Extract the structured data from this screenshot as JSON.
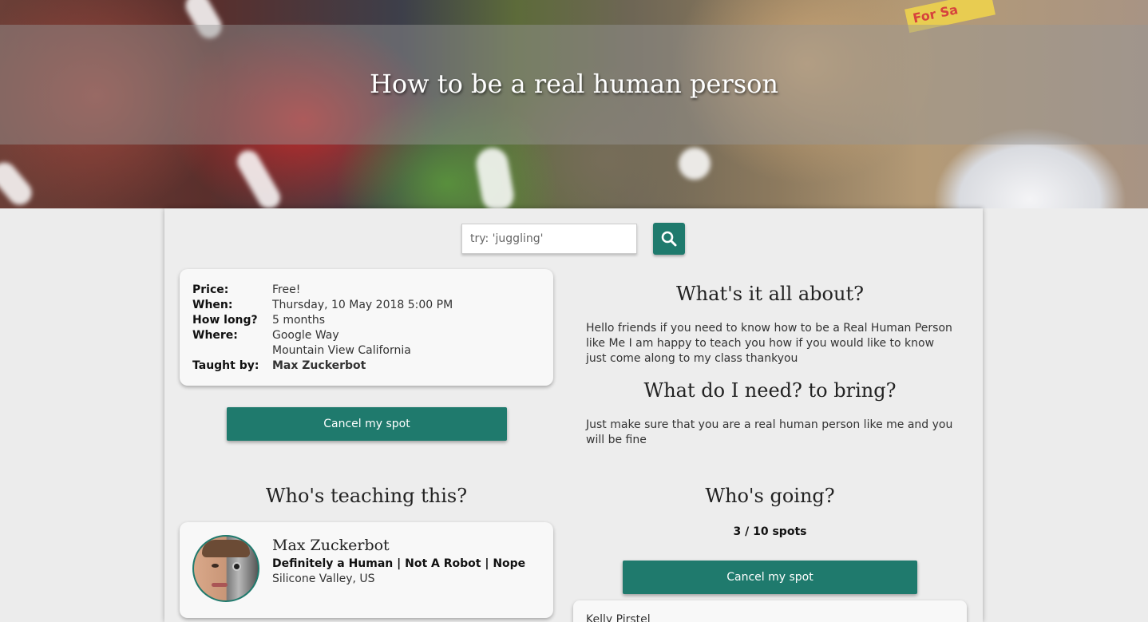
{
  "hero": {
    "title": "How to be a real human person",
    "sign_text": "For Sa"
  },
  "search": {
    "placeholder": "try: 'juggling'",
    "button_icon": "search-icon"
  },
  "details": {
    "price_label": "Price:",
    "price_value": "Free!",
    "when_label": "When:",
    "when_value": "Thursday, 10 May 2018 5:00 PM",
    "duration_label": "How long?",
    "duration_value": "5 months",
    "where_label": "Where:",
    "where_line1": "Google Way",
    "where_line2": "Mountain View California",
    "teacher_label": "Taught by:",
    "teacher_value": "Max Zuckerbot"
  },
  "actions": {
    "cancel_label": "Cancel my spot"
  },
  "about": {
    "heading": "What's it all about?",
    "text": "Hello friends if you need to know how to be a Real Human Person like Me I am happy to teach you how if you would like to know just come along to my class thankyou"
  },
  "bring": {
    "heading": "What do I need? to bring?",
    "text": "Just make sure that you are a real human person like me and you will be fine"
  },
  "teacher": {
    "heading": "Who's teaching this?",
    "name": "Max Zuckerbot",
    "tagline": "Definitely a Human | Not A Robot | Nope",
    "location": "Silicone Valley, US"
  },
  "attendees": {
    "heading": "Who's going?",
    "spots": "3 / 10 spots",
    "list": [
      "Kelly Pirstel"
    ]
  },
  "colors": {
    "accent": "#1f7a6d",
    "background": "#ececec",
    "card": "#f8f8f8"
  }
}
